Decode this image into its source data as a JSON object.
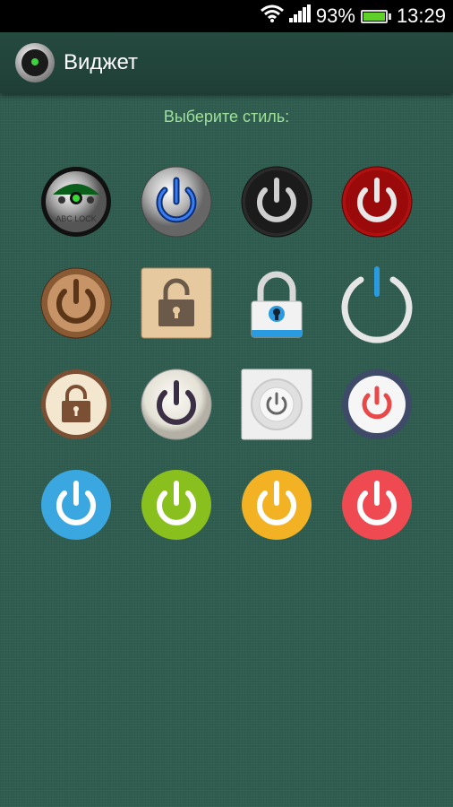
{
  "status_bar": {
    "battery_percent": "93%",
    "time": "13:29"
  },
  "header": {
    "title": "Виджет"
  },
  "prompt": "Выберите стиль:",
  "icons": [
    "abc-lock-icon",
    "chrome-power-blue-icon",
    "dark-carbon-power-icon",
    "red-fabric-power-icon",
    "wood-power-icon",
    "wood-padlock-icon",
    "padlock-icon",
    "ring-power-blue-icon",
    "beige-padlock-icon",
    "pearl-power-icon",
    "square-power-icon",
    "navy-power-icon",
    "blue-power-icon",
    "green-power-icon",
    "yellow-power-icon",
    "red-power-icon"
  ],
  "colors": {
    "background": "#2f5d4f",
    "prompt": "#9fe09a",
    "battery": "#5fcf2a"
  }
}
